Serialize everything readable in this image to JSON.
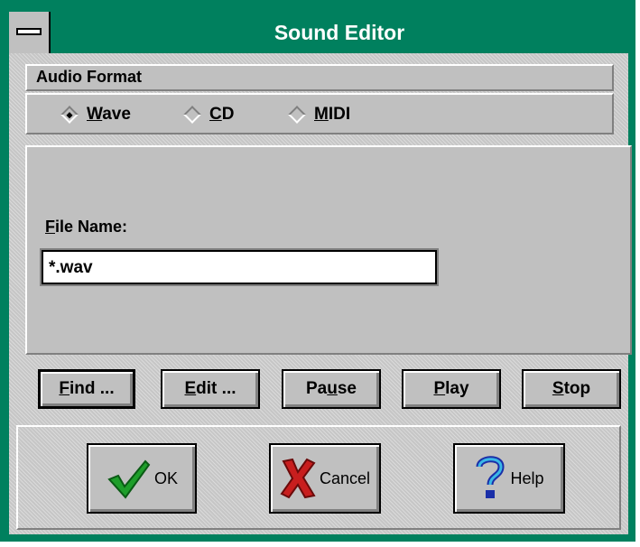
{
  "window": {
    "title": "Sound Editor"
  },
  "audio_format": {
    "label": "Audio Format",
    "options": [
      {
        "prefix": "",
        "accel": "W",
        "rest": "ave",
        "selected": true
      },
      {
        "prefix": "",
        "accel": "C",
        "rest": "D",
        "selected": false
      },
      {
        "prefix": "",
        "accel": "M",
        "rest": "IDI",
        "selected": false
      }
    ]
  },
  "file": {
    "label_accel": "F",
    "label_rest": "ile Name:",
    "value": "*.wav"
  },
  "actions": [
    {
      "accel": "F",
      "rest": "ind ..."
    },
    {
      "accel": "E",
      "rest": "dit ..."
    },
    {
      "pre": "Pa",
      "accel": "u",
      "rest": "se"
    },
    {
      "accel": "P",
      "rest": "lay"
    },
    {
      "accel": "S",
      "rest": "top"
    }
  ],
  "dialog_buttons": {
    "ok": "OK",
    "cancel": "Cancel",
    "help": "Help"
  },
  "colors": {
    "title_bar": "#00805e",
    "face": "#c0c0c0"
  },
  "icons": {
    "ok": "checkmark-icon",
    "cancel": "x-icon",
    "help": "question-mark-icon"
  }
}
